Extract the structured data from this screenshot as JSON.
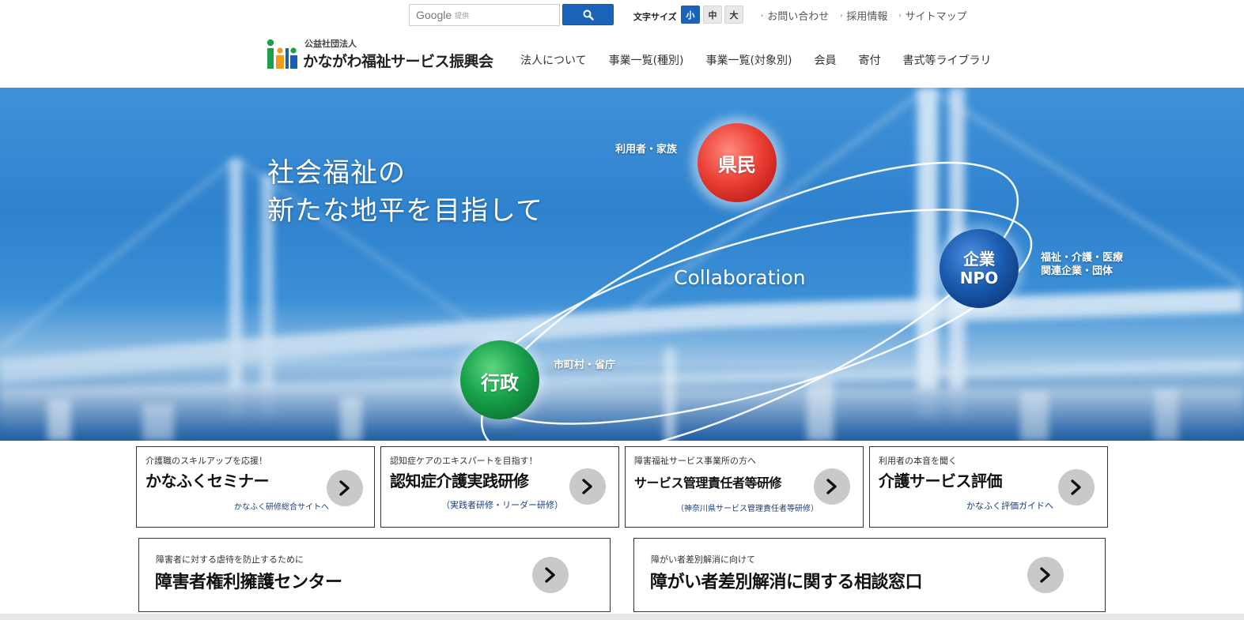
{
  "search": {
    "brand": "Google",
    "provided_by": "提供",
    "value": ""
  },
  "font_size": {
    "label": "文字サイズ",
    "small": "小",
    "medium": "中",
    "large": "大",
    "selected": "小"
  },
  "top_links": [
    {
      "label": "お問い合わせ"
    },
    {
      "label": "採用情報"
    },
    {
      "label": "サイトマップ"
    }
  ],
  "logo": {
    "sub": "公益社団法人",
    "name": "かながわ福祉サービス振興会"
  },
  "nav": [
    {
      "label": "法人について"
    },
    {
      "label": "事業一覧(種別)"
    },
    {
      "label": "事業一覧(対象別)"
    },
    {
      "label": "会員"
    },
    {
      "label": "寄付"
    },
    {
      "label": "書式等ライブラリ"
    }
  ],
  "hero": {
    "headline_line1": "社会福祉の",
    "headline_line2": "新たな地平を目指して",
    "collaboration": "Collaboration",
    "nodes": {
      "citizens": {
        "label": "県民",
        "annotation": "利用者・家族",
        "color": "#e8403a"
      },
      "companies": {
        "label_line1": "企業",
        "label_line2": "NPO",
        "annotation_line1": "福祉・介護・医療",
        "annotation_line2": "関連企業・団体",
        "color": "#1757a8"
      },
      "government": {
        "label": "行政",
        "annotation": "市町村・省庁",
        "color": "#15a04a"
      }
    }
  },
  "cards": [
    {
      "kicker": "介護職のスキルアップを応援！",
      "title": "かなふくセミナー",
      "sub": "かなふく研修総合サイトへ"
    },
    {
      "kicker": "認知症ケアのエキスパートを目指す！",
      "title": "認知症介護実践研修",
      "sub": "（実践者研修・リーダー研修）"
    },
    {
      "kicker": "障害福祉サービス事業所の方へ",
      "title": "サービス管理責任者等研修",
      "sub": "（神奈川県サービス管理責任者等研修）"
    },
    {
      "kicker": "利用者の本音を聞く",
      "title": "介護サービス評価",
      "sub": "かなふく評価ガイドへ"
    }
  ],
  "wide_cards": [
    {
      "kicker": "障害者に対する虐待を防止するために",
      "title": "障害者権利擁護センター"
    },
    {
      "kicker": "障がい者差別解消に向けて",
      "title": "障がい者差別解消に関する相談窓口"
    }
  ],
  "colors": {
    "accent": "#1a63b9",
    "card_border": "#333333",
    "arrow_bg": "#c9c9c9"
  }
}
